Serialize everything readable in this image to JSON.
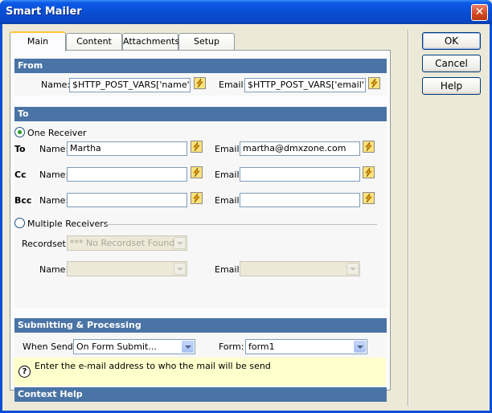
{
  "window": {
    "title": "Smart Mailer",
    "close_glyph": "✕"
  },
  "tabs": [
    {
      "label": "Main",
      "active": true
    },
    {
      "label": "Content",
      "active": false
    },
    {
      "label": "Attachments",
      "active": false
    },
    {
      "label": "Setup",
      "active": false
    }
  ],
  "buttons": {
    "ok": "OK",
    "cancel": "Cancel",
    "help": "Help"
  },
  "sections": {
    "from": "From",
    "to": "To",
    "submitting": "Submitting & Processing",
    "context_help": "Context Help"
  },
  "from": {
    "name_label": "Name:",
    "name_value": "$HTTP_POST_VARS['name']",
    "email_label": "Email:",
    "email_value": "$HTTP_POST_VARS['email']"
  },
  "to": {
    "one_receiver_label": "One Receiver",
    "one_receiver_selected": true,
    "rows": [
      {
        "type": "To",
        "name_label": "Name:",
        "name_value": "Martha",
        "email_label": "Email:",
        "email_value": "martha@dmxzone.com"
      },
      {
        "type": "Cc",
        "name_label": "Name:",
        "name_value": "",
        "email_label": "Email:",
        "email_value": ""
      },
      {
        "type": "Bcc",
        "name_label": "Name:",
        "name_value": "",
        "email_label": "Email:",
        "email_value": ""
      }
    ],
    "multiple_receivers_label": "Multiple Receivers",
    "recordset_label": "Recordset:",
    "recordset_value": "*** No Recordset Found",
    "multi_name_label": "Name:",
    "multi_email_label": "Email:"
  },
  "submitting": {
    "when_send_label": "When Send:",
    "when_send_value": "On Form Submit...",
    "form_label": "Form:",
    "form_value": "form1"
  },
  "help": {
    "icon": "?",
    "text": "Enter the e-mail address to who the mail will be send"
  },
  "colors": {
    "section_bar": "#4a74a6",
    "help_background": "#ffffcc",
    "title_bar": "#0a4fd6"
  }
}
